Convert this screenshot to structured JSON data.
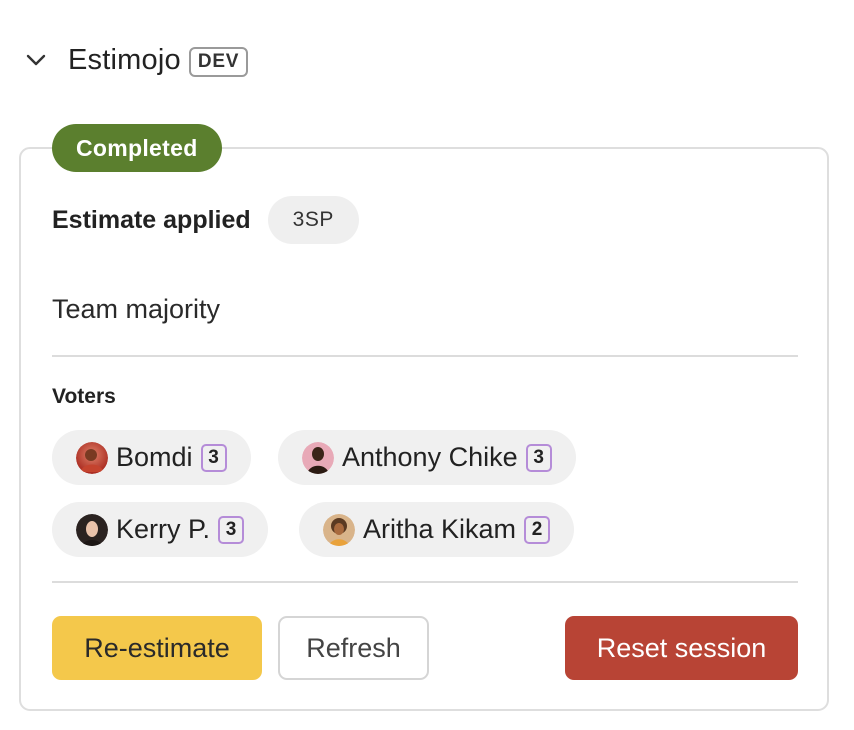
{
  "header": {
    "app_name": "Estimojo",
    "env_badge": "DEV",
    "collapse_icon": "chevron-down-icon"
  },
  "session": {
    "status": "Completed",
    "status_color": "#5b7f2e",
    "estimate_label": "Estimate applied",
    "estimate_value": "3SP",
    "method": "Team majority"
  },
  "voters": {
    "heading": "Voters",
    "badge_border_color": "#b58cd8",
    "items": [
      {
        "name": "Bomdi",
        "vote": "3",
        "avatar": "avatar-photo"
      },
      {
        "name": "Anthony Chike",
        "vote": "3",
        "avatar": "avatar-photo"
      },
      {
        "name": "Kerry P.",
        "vote": "3",
        "avatar": "avatar-photo"
      },
      {
        "name": "Aritha Kikam",
        "vote": "2",
        "avatar": "avatar-photo"
      }
    ]
  },
  "actions": {
    "reestimate_label": "Re-estimate",
    "refresh_label": "Refresh",
    "reset_label": "Reset session",
    "reestimate_color": "#f4c84b",
    "reset_color": "#b84435"
  }
}
